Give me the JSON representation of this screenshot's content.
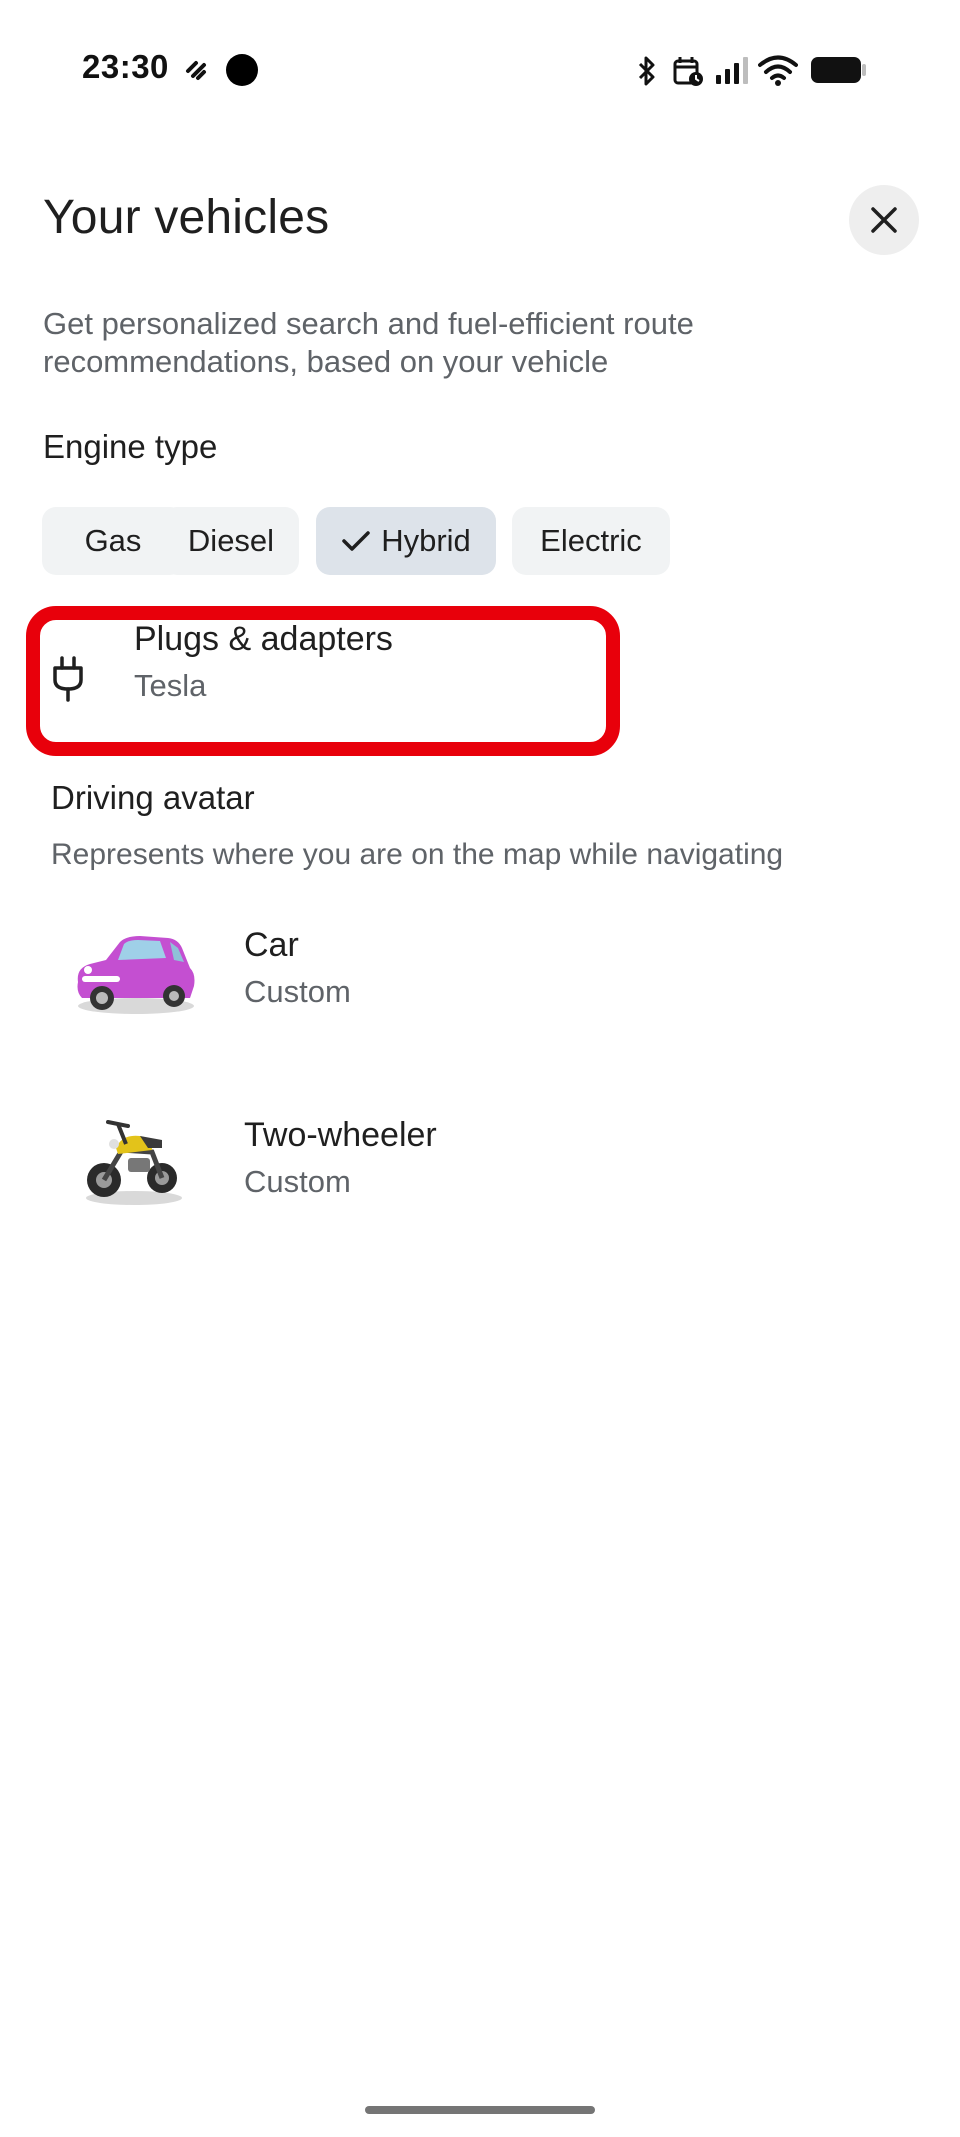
{
  "status_bar": {
    "time": "23:30"
  },
  "header": {
    "title": "Your vehicles"
  },
  "description": "Get personalized search and fuel-efficient route recommendations, based on your vehicle",
  "engine": {
    "label": "Engine type",
    "options": [
      "Gas",
      "Diesel",
      "Hybrid",
      "Electric"
    ],
    "selected": "Hybrid"
  },
  "plugs": {
    "title": "Plugs & adapters",
    "subtitle": "Tesla"
  },
  "avatar": {
    "heading": "Driving avatar",
    "description": "Represents where you are on the map while navigating",
    "items": [
      {
        "title": "Car",
        "subtitle": "Custom",
        "icon": "car-avatar-icon"
      },
      {
        "title": "Two-wheeler",
        "subtitle": "Custom",
        "icon": "motorcycle-avatar-icon"
      }
    ]
  },
  "colors": {
    "highlight": "#e8000b",
    "chip_bg": "#f1f3f4",
    "chip_selected_bg": "#dde3ea",
    "car_body": "#c44fd1",
    "bike_tank": "#e3c31a"
  }
}
